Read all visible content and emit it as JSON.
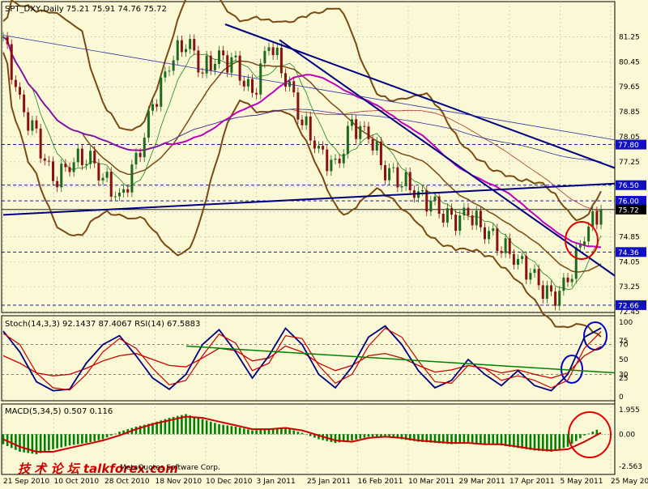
{
  "colors": {
    "background": "#fbf8d6",
    "grid": "#b8b8b8",
    "axis_text": "#000000",
    "bull_candle": "#1c6b1c",
    "bear_candle": "#8b1010",
    "bollinger": "#7a4a14",
    "ma_short": "#1a8a1a",
    "ma_medium": "#c000c0",
    "ma_long": "#b03030",
    "ma_very_long": "#3030a0",
    "trendline": "#000080",
    "stoch_main": "#000080",
    "stoch_signal": "#cc0000",
    "stoch_trend": "#008000",
    "macd_hist": "#008000",
    "macd_signal": "#cc0000",
    "circle_red": "#e00000",
    "circle_blue": "#0000cc",
    "price_label_bg": "#1010c0",
    "current_label_bg": "#000000",
    "watermark": "#cc0000"
  },
  "price_panel": {
    "header": "SPT_DXY,Daily  75.21 75.91 74.76 75.72",
    "ticks": [
      "81.25",
      "80.45",
      "79.65",
      "78.85",
      "78.05",
      "77.25",
      "76.45",
      "75.65",
      "74.85",
      "74.05",
      "73.25",
      "72.45"
    ],
    "labels": [
      "77.80",
      "76.50",
      "76.00",
      "75.72",
      "74.36",
      "72.66"
    ]
  },
  "stoch_panel": {
    "header": "Stoch(14,3,3) 92.1437 87.4067  RSI(14) 67.5883",
    "ticks": [
      "100",
      "75",
      "70",
      "50",
      "30",
      "25",
      "0"
    ]
  },
  "macd_panel": {
    "header": "MACD(5,34,5) 0.507 0.116",
    "ticks": [
      "1.955",
      "0.00",
      "-2.563"
    ]
  },
  "x_axis": {
    "labels": [
      "21 Sep 2010",
      "10 Oct 2010",
      "28 Oct 2010",
      "18 Nov 2010",
      "10 Dec 2010",
      "3 Jan 2011",
      "25 Jan 2011",
      "16 Feb 2011",
      "10 Mar 2011",
      "29 Mar 2011",
      "17 Apr 2011",
      "5 May 2011",
      "25 May 2011"
    ]
  },
  "watermark": {
    "text": "技 术 论 坛  talkforex.com",
    "credit": "MetaQuotes Software Corp."
  },
  "chart_data": [
    {
      "type": "candlestick",
      "title": "SPT_DXY,Daily",
      "ohlc_last": {
        "open": 75.21,
        "high": 75.91,
        "low": 74.76,
        "close": 75.72
      },
      "ylim": [
        72.45,
        81.65
      ],
      "price_levels": [
        77.8,
        76.5,
        76.0,
        75.72,
        74.36,
        72.66
      ],
      "x": [
        "21 Sep 2010",
        "10 Oct 2010",
        "28 Oct 2010",
        "18 Nov 2010",
        "10 Dec 2010",
        "3 Jan 2011",
        "25 Jan 2011",
        "16 Feb 2011",
        "10 Mar 2011",
        "29 Mar 2011",
        "17 Apr 2011",
        "5 May 2011",
        "25 May 2011"
      ],
      "close_path": [
        81.25,
        79.1,
        78.0,
        76.6,
        77.2,
        77.5,
        76.8,
        76.0,
        77.2,
        79.0,
        80.4,
        81.2,
        80.2,
        80.6,
        80.3,
        79.3,
        81.1,
        80.0,
        78.6,
        77.6,
        77.0,
        78.4,
        78.1,
        77.0,
        76.7,
        76.2,
        75.8,
        75.3,
        75.6,
        75.1,
        74.6,
        74.1,
        73.5,
        72.8,
        73.4,
        75.0,
        75.72
      ]
    },
    {
      "type": "line",
      "title": "Stoch(14,3,3) 92.1437 87.4067  RSI(14) 67.5883",
      "ylim": [
        0,
        100
      ],
      "series": [
        {
          "name": "Stoch(14,3,3)",
          "values": [
            88,
            60,
            20,
            8,
            10,
            45,
            70,
            82,
            55,
            25,
            10,
            30,
            70,
            90,
            60,
            25,
            55,
            92,
            70,
            30,
            12,
            40,
            80,
            95,
            70,
            35,
            12,
            22,
            50,
            30,
            15,
            35,
            15,
            8,
            30,
            80,
            92.14
          ]
        },
        {
          "name": "Stoch(14,3,3)",
          "values": [
            85,
            70,
            32,
            12,
            9,
            30,
            60,
            78,
            65,
            38,
            16,
            22,
            55,
            84,
            72,
            35,
            45,
            82,
            78,
            42,
            18,
            30,
            68,
            92,
            80,
            48,
            20,
            18,
            42,
            38,
            22,
            28,
            22,
            12,
            22,
            65,
            87.41
          ]
        },
        {
          "name": "RSI(14)",
          "values": [
            55,
            45,
            32,
            28,
            30,
            38,
            48,
            55,
            58,
            50,
            42,
            40,
            52,
            65,
            62,
            48,
            52,
            68,
            60,
            45,
            35,
            42,
            55,
            58,
            52,
            42,
            33,
            36,
            42,
            38,
            32,
            36,
            30,
            25,
            32,
            55,
            67.59
          ]
        }
      ]
    },
    {
      "type": "bar",
      "title": "MACD(5,34,5) 0.507 0.116",
      "ylim": [
        -2.563,
        1.955
      ],
      "series": [
        {
          "name": "MACD(5,34,5)",
          "values": [
            -0.8,
            -1.4,
            -1.6,
            -1.2,
            -0.9,
            -0.7,
            -0.4,
            0.2,
            0.6,
            0.9,
            1.3,
            1.6,
            1.2,
            0.8,
            0.6,
            0.3,
            0.4,
            0.5,
            0.1,
            -0.4,
            -0.7,
            -0.5,
            -0.2,
            -0.2,
            -0.4,
            -0.6,
            -0.7,
            -0.8,
            -0.7,
            -0.8,
            -0.9,
            -1.1,
            -1.3,
            -1.4,
            -1.0,
            -0.1,
            0.507
          ]
        },
        {
          "name": "MACD(5,34,5)",
          "values": [
            -0.4,
            -1.0,
            -1.4,
            -1.4,
            -1.1,
            -0.8,
            -0.5,
            -0.1,
            0.4,
            0.8,
            1.1,
            1.4,
            1.3,
            1.0,
            0.7,
            0.4,
            0.4,
            0.5,
            0.3,
            -0.1,
            -0.5,
            -0.6,
            -0.3,
            -0.2,
            -0.3,
            -0.5,
            -0.6,
            -0.7,
            -0.7,
            -0.8,
            -0.8,
            -1.0,
            -1.2,
            -1.3,
            -1.2,
            -0.6,
            0.116
          ]
        }
      ]
    }
  ]
}
